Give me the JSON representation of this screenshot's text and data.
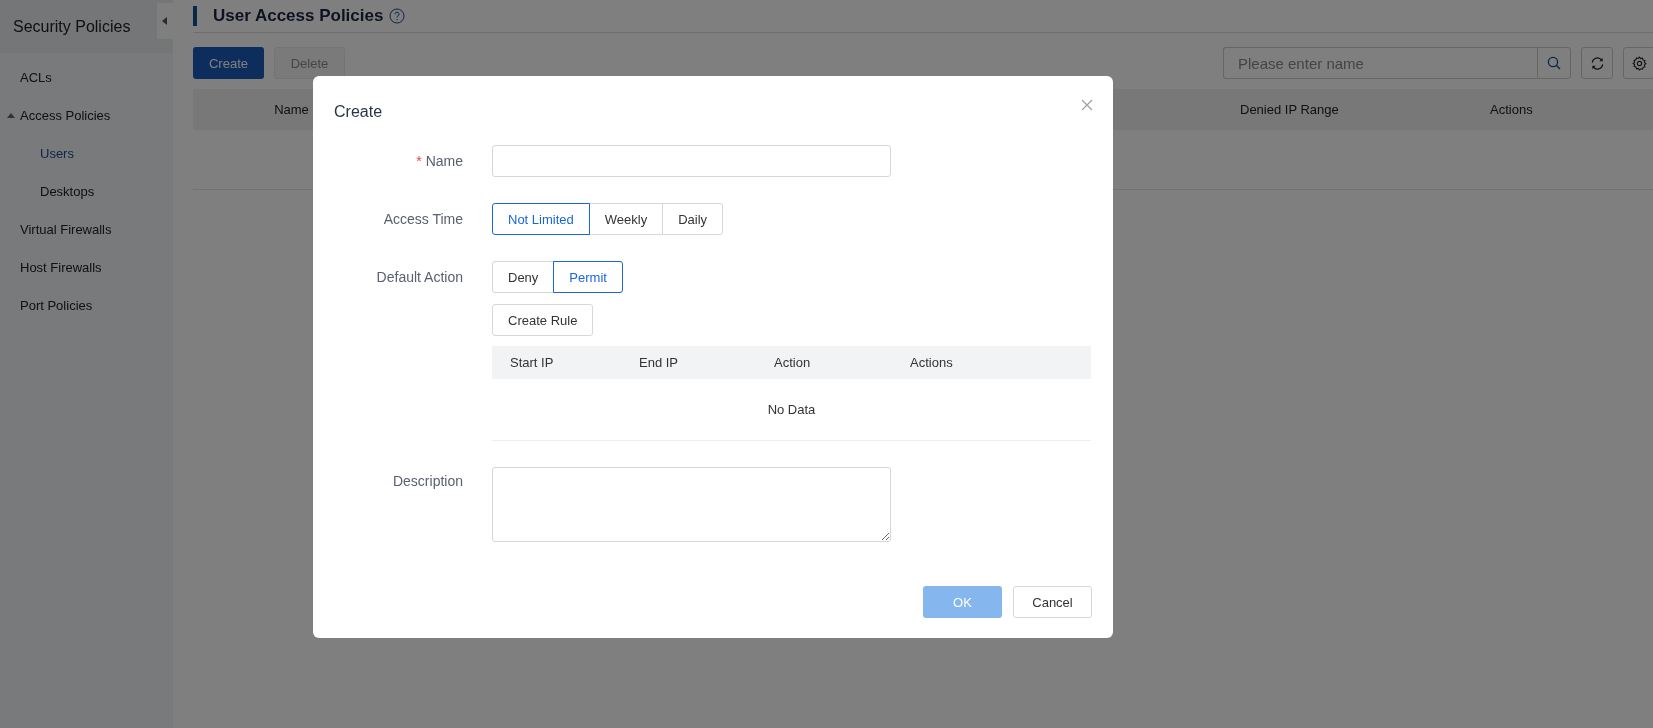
{
  "sidebar": {
    "title": "Security Policies",
    "items": [
      {
        "label": "ACLs",
        "selected": false
      },
      {
        "label": "Access Policies",
        "selected": false,
        "expanded": true,
        "children": [
          {
            "label": "Users",
            "selected": true
          },
          {
            "label": "Desktops",
            "selected": false
          }
        ]
      },
      {
        "label": "Virtual Firewalls",
        "selected": false
      },
      {
        "label": "Host Firewalls",
        "selected": false
      },
      {
        "label": "Port Policies",
        "selected": false
      }
    ]
  },
  "page": {
    "title": "User Access Policies",
    "toolbar": {
      "buttons": [
        {
          "label": "Create",
          "kind": "primary",
          "disabled": false
        },
        {
          "label": "Delete",
          "kind": "default",
          "disabled": true
        }
      ],
      "search": {
        "placeholder": "Please enter name"
      }
    },
    "table": {
      "columns": [
        "Name",
        "Denied IP Range",
        "Actions"
      ]
    }
  },
  "dialog": {
    "title": "Create",
    "name": {
      "label": "Name",
      "required_mark": "*"
    },
    "access_time": {
      "label": "Access Time",
      "options": [
        {
          "label": "Not Limited",
          "selected": true
        },
        {
          "label": "Weekly",
          "selected": false
        },
        {
          "label": "Daily",
          "selected": false
        }
      ]
    },
    "default_action": {
      "label": "Default Action",
      "options": [
        {
          "label": "Deny",
          "selected": false
        },
        {
          "label": "Permit",
          "selected": true
        }
      ]
    },
    "create_rule_button": "Create Rule",
    "rules_table": {
      "columns": [
        "Start IP",
        "End IP",
        "Action",
        "Actions"
      ],
      "empty_text": "No Data"
    },
    "description": {
      "label": "Description"
    },
    "buttons": [
      {
        "label": "OK",
        "kind": "primary",
        "disabled": true
      },
      {
        "label": "Cancel",
        "kind": "default",
        "disabled": false
      }
    ]
  }
}
